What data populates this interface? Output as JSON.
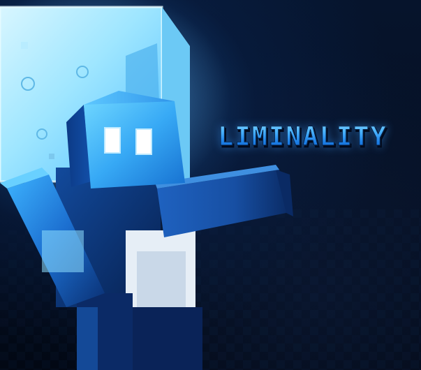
{
  "logo": {
    "title": "LIMINALITY"
  },
  "artwork": {
    "subject": "blocky-blue-character-icon",
    "accent_color": "#3aa6ff",
    "glow_color": "#8fdcff",
    "background_color": "#030a18"
  }
}
